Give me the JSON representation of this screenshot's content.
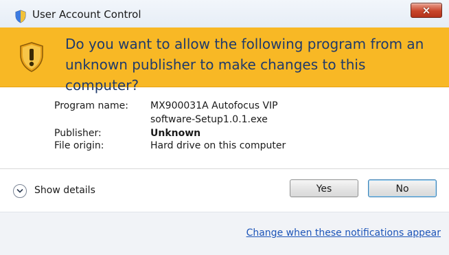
{
  "window": {
    "title": "User Account Control",
    "close_label": "×"
  },
  "banner": {
    "line1": "Do you want to allow the following program from an",
    "line2": "unknown publisher to make changes to this computer?"
  },
  "details": {
    "program_name_label": "Program name:",
    "program_name_line1": "MX900031A Autofocus VIP",
    "program_name_line2": "software-Setup1.0.1.exe",
    "publisher_label": "Publisher:",
    "publisher_value": "Unknown",
    "file_origin_label": "File origin:",
    "file_origin_value": "Hard drive on this computer"
  },
  "actions": {
    "show_details": "Show details",
    "yes": "Yes",
    "no": "No"
  },
  "footer": {
    "link": "Change when these notifications appear"
  },
  "colors": {
    "banner": "#f8b825",
    "banner_text": "#1f3a6b",
    "link": "#1c54b8",
    "close_button": "#c8452b"
  },
  "icons": {
    "title": "uac-shield-icon",
    "banner": "warning-shield-icon",
    "close": "close-icon",
    "toggle": "chevron-down-icon"
  }
}
